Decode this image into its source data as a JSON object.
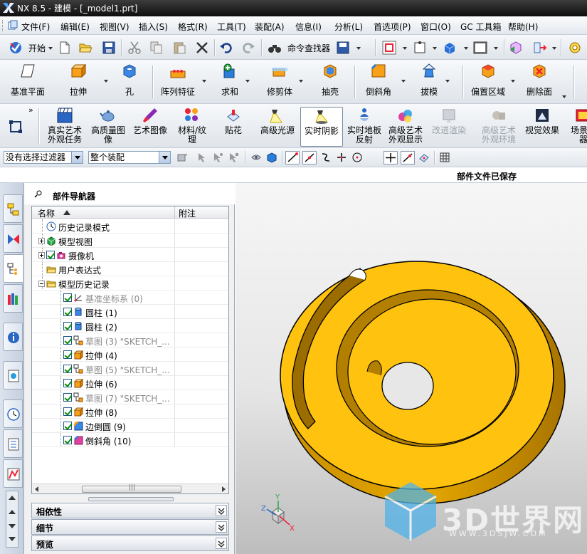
{
  "window": {
    "title": "NX 8.5 - 建模 - [_model1.prt]"
  },
  "menu": [
    "文件(F)",
    "编辑(E)",
    "视图(V)",
    "插入(S)",
    "格式(R)",
    "工具(T)",
    "装配(A)",
    "信息(I)",
    "分析(L)",
    "首选项(P)",
    "窗口(O)",
    "GC 工具箱",
    "帮助(H)"
  ],
  "standard_toolbar": {
    "start_label": "开始",
    "command_finder_label": "命令查找器"
  },
  "feature_toolbar": [
    "基准平面",
    "拉伸",
    "孔",
    "阵列特征",
    "求和",
    "修剪体",
    "抽壳",
    "倒斜角",
    "拔模",
    "偏置区域",
    "删除面"
  ],
  "render_toolbar": [
    {
      "label": "真实艺术\n外观任务",
      "state": "normal"
    },
    {
      "label": "高质量图\n像",
      "state": "normal"
    },
    {
      "label": "艺术图像",
      "state": "normal"
    },
    {
      "label": "材料/纹\n理",
      "state": "normal"
    },
    {
      "label": "贴花",
      "state": "normal"
    },
    {
      "label": "高级光源",
      "state": "normal"
    },
    {
      "label": "实时阴影",
      "state": "active"
    },
    {
      "label": "实时地板\n反射",
      "state": "normal"
    },
    {
      "label": "高级艺术\n外观显示",
      "state": "normal"
    },
    {
      "label": "改进渲染",
      "state": "disabled"
    },
    {
      "label": "高级艺术\n外观环境",
      "state": "disabled"
    },
    {
      "label": "视觉效果",
      "state": "normal"
    },
    {
      "label": "场景编\n器",
      "state": "normal"
    }
  ],
  "selection_bar": {
    "filter_value": "没有选择过滤器",
    "scope_value": "整个装配"
  },
  "status": {
    "message": "部件文件已保存"
  },
  "navigator": {
    "title": "部件导航器",
    "columns": {
      "name": "名称",
      "note": "附注"
    },
    "rows": [
      {
        "label": "历史记录模式",
        "icon": "clock-icon",
        "indent": 0,
        "expander": "none",
        "checked": false,
        "grey": false
      },
      {
        "label": "模型视图",
        "icon": "model-views-icon",
        "indent": 0,
        "expander": "plus",
        "checked": false,
        "grey": false
      },
      {
        "label": "摄像机",
        "icon": "camera-icon",
        "indent": 0,
        "expander": "plus",
        "checked": true,
        "grey": false
      },
      {
        "label": "用户表达式",
        "icon": "folder-icon",
        "indent": 0,
        "expander": "none",
        "checked": false,
        "grey": false
      },
      {
        "label": "模型历史记录",
        "icon": "folder-icon",
        "indent": 0,
        "expander": "minus",
        "checked": false,
        "grey": false
      },
      {
        "label": "基准坐标系 (0)",
        "icon": "datum-csys-icon",
        "indent": 1,
        "expander": "none",
        "checked": true,
        "grey": true
      },
      {
        "label": "圆柱 (1)",
        "icon": "cylinder-icon",
        "indent": 1,
        "expander": "none",
        "checked": true,
        "grey": false
      },
      {
        "label": "圆柱 (2)",
        "icon": "cylinder-icon",
        "indent": 1,
        "expander": "none",
        "checked": true,
        "grey": false
      },
      {
        "label": "草图 (3) \"SKETCH_...",
        "icon": "sketch-icon",
        "indent": 1,
        "expander": "none",
        "checked": true,
        "grey": true
      },
      {
        "label": "拉伸 (4)",
        "icon": "extrude-icon",
        "indent": 1,
        "expander": "none",
        "checked": true,
        "grey": false
      },
      {
        "label": "草图 (5) \"SKETCH_...",
        "icon": "sketch-icon",
        "indent": 1,
        "expander": "none",
        "checked": true,
        "grey": true
      },
      {
        "label": "拉伸 (6)",
        "icon": "extrude-icon",
        "indent": 1,
        "expander": "none",
        "checked": true,
        "grey": false
      },
      {
        "label": "草图 (7) \"SKETCH_...",
        "icon": "sketch-icon",
        "indent": 1,
        "expander": "none",
        "checked": true,
        "grey": true
      },
      {
        "label": "拉伸 (8)",
        "icon": "extrude-icon",
        "indent": 1,
        "expander": "none",
        "checked": true,
        "grey": false
      },
      {
        "label": "边倒圆 (9)",
        "icon": "edge-blend-icon",
        "indent": 1,
        "expander": "none",
        "checked": true,
        "grey": false
      },
      {
        "label": "倒斜角 (10)",
        "icon": "chamfer-icon",
        "indent": 1,
        "expander": "none",
        "checked": true,
        "grey": false
      }
    ],
    "panels": [
      "相依性",
      "细节",
      "预览"
    ]
  },
  "viewport": {
    "part_color": "#ffc20e",
    "triad": {
      "x": "X",
      "y": "Y",
      "z": "Z"
    },
    "watermark": {
      "title": "3D世界网",
      "url": "WWW.3DSJW.COM"
    }
  }
}
